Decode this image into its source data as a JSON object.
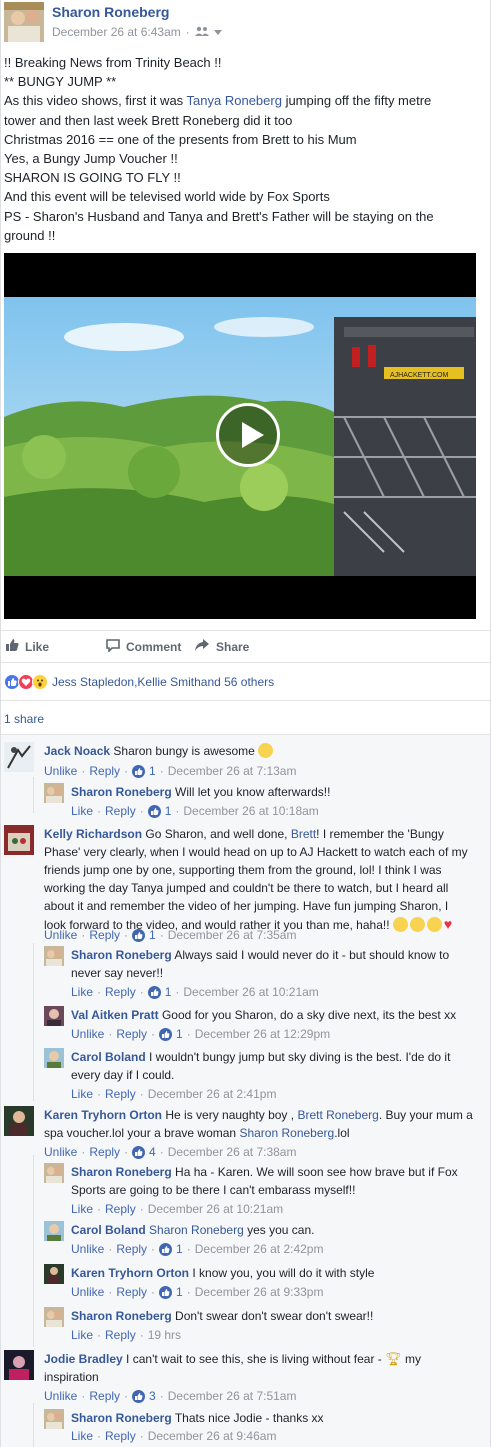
{
  "post": {
    "author": "Sharon Roneberg",
    "timestamp": "December 26 at 6:43am",
    "audience_icon": "friends-icon",
    "lines": [
      "!! Breaking News from Trinity Beach !!",
      "** BUNGY JUMP **",
      "As this video shows, first it was ",
      "tower and then last week Brett Roneberg did it too",
      "Christmas 2016 == one of the presents from Brett to his Mum",
      "Yes, a Bungy Jump Voucher !!",
      "SHARON IS GOING TO FLY !!",
      "And this event will be televised world wide by Fox Sports",
      "PS - Sharon's Husband and Tanya and Brett's Father will be staying on the",
      "ground !!"
    ],
    "line3_link": "Tanya Roneberg",
    "line3_after": " jumping off the fifty metre",
    "video_watermark": "AJHACKETT.COM"
  },
  "actions": {
    "like": "Like",
    "comment": "Comment",
    "share": "Share"
  },
  "reactions": {
    "summary_a": "Jess Stapledon",
    "sep": ", ",
    "summary_b": "Kellie Smith",
    "summary_c": " and 56 others"
  },
  "shares": "1 share",
  "footer": {
    "like": "Like",
    "unlike": "Unlike",
    "reply": "Reply",
    "dot": "·"
  },
  "comments": [
    {
      "name": "Jack Noack",
      "text": "Sharon bungy is awesome",
      "liked": true,
      "likes": "1",
      "time": "December 26 at 7:13am"
    },
    {
      "name": "Sharon Roneberg",
      "text": "Will let you know afterwards!!",
      "liked": false,
      "likes": "1",
      "time": "December 26 at 10:18am"
    },
    {
      "name": "Kelly Richardson",
      "text_lines": [
        "Go Sharon, and well done, ",
        "Phase' very clearly, when I would head on up to AJ Hackett to watch each of my",
        "friends jump one by one, supporting them from the ground, lol! I think I was",
        "working the day Tanya jumped and couldn't be there to watch, but I heard all",
        "about it and remember the video of her jumping. Have fun jumping Sharon, I",
        "look forward to the video, and would rather it you than me, haha!!"
      ],
      "link": "Brett",
      "after_link": "! I remember the 'Bungy",
      "liked": true,
      "likes": "1",
      "time": "December 26 at 7:35am"
    },
    {
      "name": "Sharon Roneberg",
      "text_lines": [
        "Always said I would never do it - but should know to",
        "never say never!!"
      ],
      "liked": false,
      "likes": "1",
      "time": "December 26 at 10:21am"
    },
    {
      "name": "Val Aitken Pratt",
      "text": "Good for you Sharon, do a sky dive next, its the best xx",
      "liked": true,
      "likes": "1",
      "time": "December 26 at 12:29pm"
    },
    {
      "name": "Carol Boland",
      "text_lines": [
        "I wouldn't bungy jump but sky diving is the best. I'de do it",
        "every day if I could."
      ],
      "liked": false,
      "time": "December 26 at 2:41pm"
    },
    {
      "name": "Karen Tryhorn Orton",
      "pre": "He is very naughty boy , ",
      "link1": "Brett Roneberg",
      "mid": ". Buy your mum a",
      "line2a": "spa voucher.lol your a brave woman ",
      "link2": "Sharon Roneberg",
      "line2b": ".lol",
      "liked": true,
      "likes": "4",
      "time": "December 26 at 7:38am"
    },
    {
      "name": "Sharon Roneberg",
      "text_lines": [
        "Ha ha - Karen. We will soon see how brave but if Fox",
        "Sports are going to be there I can't embarass myself!!"
      ],
      "liked": false,
      "time": "December 26 at 10:21am"
    },
    {
      "name": "Carol Boland",
      "link": "Sharon Roneberg",
      "after_link": " yes you can.",
      "liked": true,
      "likes": "1",
      "time": "December 26 at 2:42pm"
    },
    {
      "name": "Karen Tryhorn Orton",
      "text": "I know you, you will do it with style",
      "liked": true,
      "likes": "1",
      "time": "December 26 at 9:33pm"
    },
    {
      "name": "Sharon Roneberg",
      "text": "Don't swear don't swear don't swear!!",
      "liked": false,
      "time": "19 hrs"
    },
    {
      "name": "Jodie Bradley",
      "text": "I can't wait to see this, she is living without fear - ",
      "text2": "my",
      "line2": "inspiration",
      "liked": true,
      "likes": "3",
      "time": "December 26 at 7:51am"
    },
    {
      "name": "Sharon Roneberg",
      "text": "Thats nice Jodie - thanks xx",
      "liked": false,
      "time": "December 26 at 9:46am"
    }
  ],
  "colors": {
    "link": "#365899",
    "meta": "#90949c",
    "accent": "#4267b2",
    "bg_comments": "#f6f7f9"
  }
}
